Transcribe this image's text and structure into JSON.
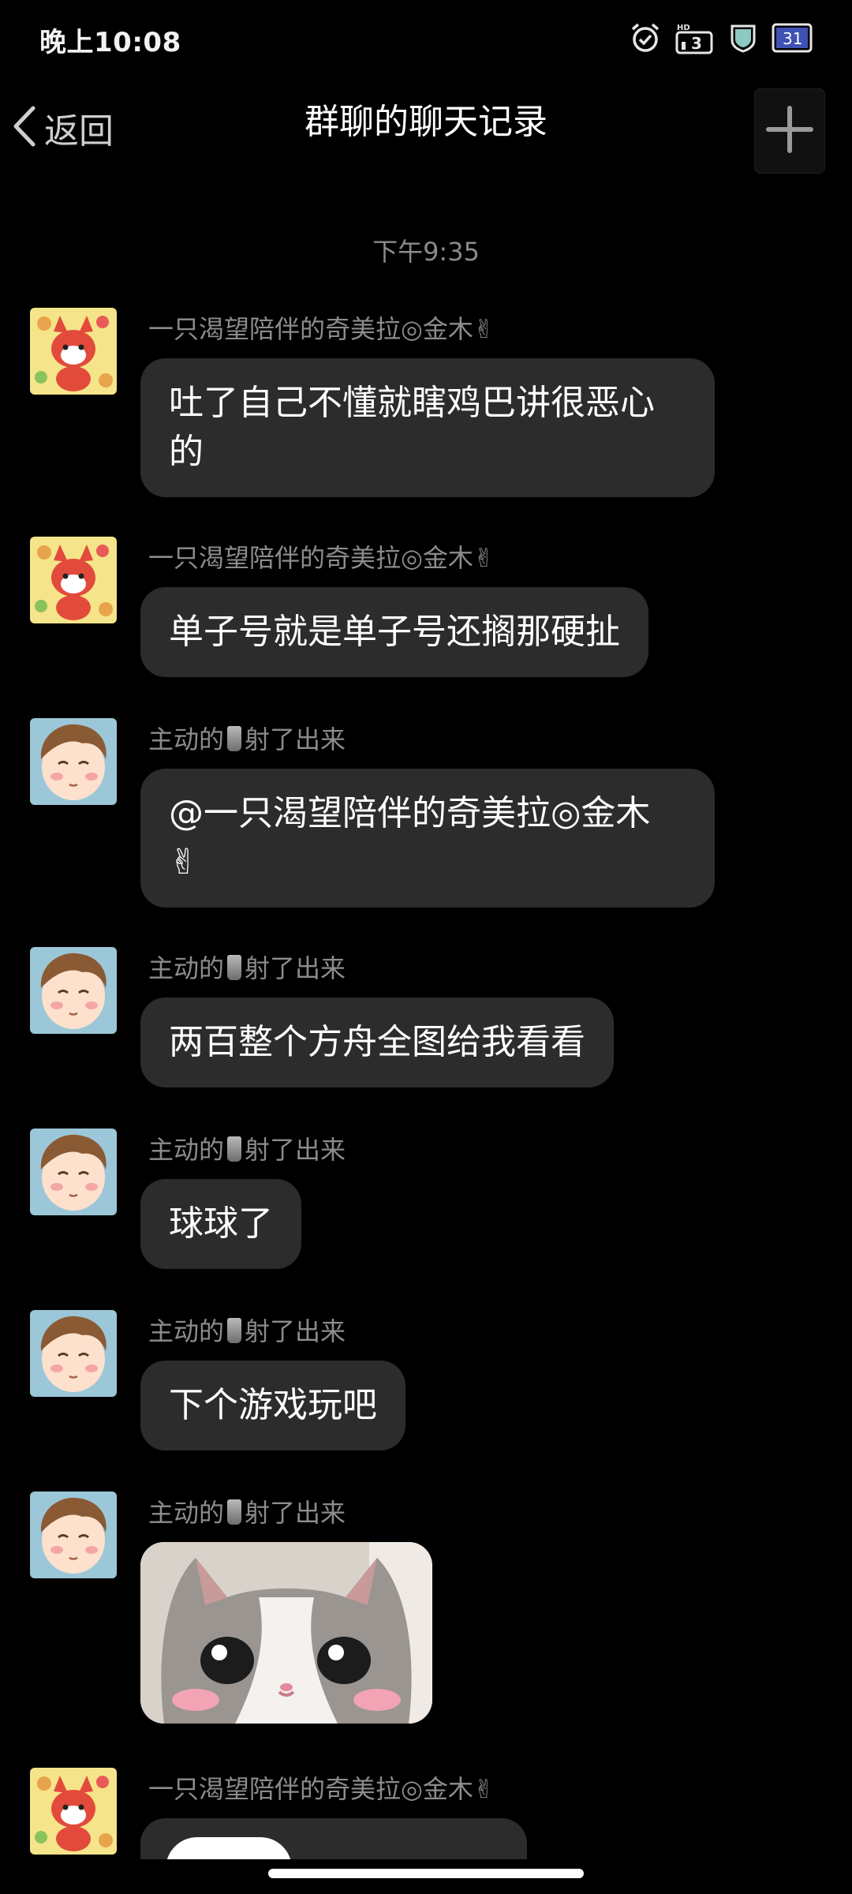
{
  "status_bar": {
    "time": "晚上10:08",
    "icons": [
      "alarm-icon",
      "hd-signal-icon",
      "shield-icon",
      "calendar-icon"
    ],
    "calendar_day": "31"
  },
  "nav": {
    "back_label": "返回",
    "title": "群聊的聊天记录",
    "add_icon": "plus-icon"
  },
  "chat": {
    "timestamp": "下午9:35",
    "senders": {
      "chimera": "一只渴望陪伴的奇美拉◎金木✌",
      "active_a": "主动的",
      "active_b": "射了出来"
    },
    "messages": [
      {
        "sender": "chimera",
        "text_line1": "吐了自己不懂就瞎鸡巴讲很恶心",
        "text_line2": "的"
      },
      {
        "sender": "chimera",
        "text": "单子号就是单子号还搁那硬扯"
      },
      {
        "sender": "active",
        "text_line1": "@一只渴望陪伴的奇美拉◎金木",
        "text_line2": "✌"
      },
      {
        "sender": "active",
        "text": "两百整个方舟全图给我看看"
      },
      {
        "sender": "active",
        "text": "球球了"
      },
      {
        "sender": "active",
        "text": "下个游戏玩吧"
      },
      {
        "sender": "active",
        "image": "crying-cat-sticker"
      },
      {
        "sender": "chimera",
        "partial": true
      }
    ]
  },
  "colors": {
    "background": "#000000",
    "bubble": "#2c2c2c",
    "sender_text": "#8c8c8c",
    "timestamp_text": "#8a8a8a"
  }
}
